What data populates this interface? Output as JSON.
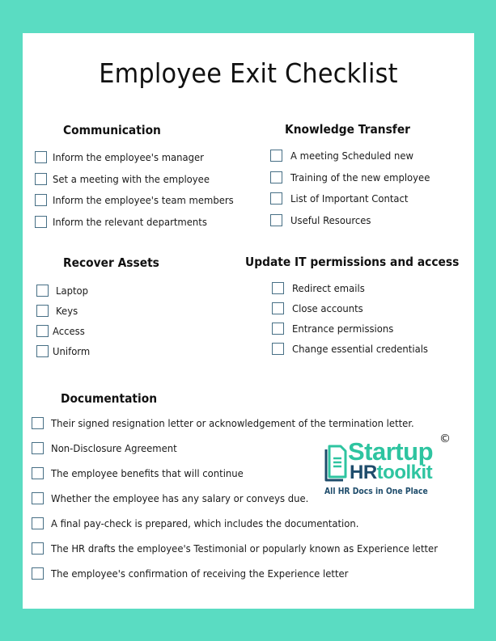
{
  "document": {
    "title": "Employee Exit Checklist"
  },
  "sections": {
    "communication": {
      "heading": "Communication",
      "items": [
        "Inform the employee's manager",
        "Set a meeting with the employee",
        "Inform the employee's team members",
        "Inform the relevant departments"
      ]
    },
    "knowledge_transfer": {
      "heading": "Knowledge Transfer",
      "items": [
        "A meeting Scheduled new",
        "Training of the new employee",
        "List of Important Contact",
        "Useful Resources"
      ]
    },
    "recover_assets": {
      "heading": "Recover Assets",
      "items": [
        "Laptop",
        "Keys",
        "Access",
        "Uniform"
      ]
    },
    "it_permissions": {
      "heading": "Update IT permissions and access",
      "items": [
        "Redirect emails",
        "Close accounts",
        "Entrance permissions",
        "Change essential credentials"
      ]
    },
    "documentation": {
      "heading": "Documentation",
      "items": [
        "Their signed resignation letter or acknowledgement of the termination letter.",
        "Non-Disclosure Agreement",
        "The employee benefits that will continue",
        "Whether the employee has any salary or conveys due.",
        "A final pay-check is prepared, which includes the documentation.",
        "The HR drafts the employee's Testimonial or popularly known as Experience letter",
        "The employee's confirmation of receiving the Experience letter"
      ]
    }
  },
  "logo": {
    "word1": "Startup",
    "word2_hr": "HR",
    "word2_rest": "toolkit",
    "copyright": "©",
    "tagline": "All HR Docs in One Place",
    "icon": "document-icon",
    "colors": {
      "teal": "#2ec4a0",
      "navy": "#1e4c6b"
    }
  },
  "colors": {
    "frame": "#5adcc2",
    "checkbox_border": "#476f85"
  }
}
